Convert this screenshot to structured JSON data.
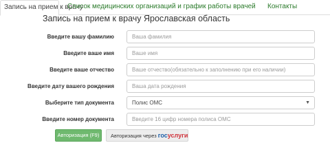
{
  "tabs": [
    {
      "label": "Запись на прием к врачу",
      "active": true
    },
    {
      "label": "Список медицинских организаций и график работы врачей",
      "active": false
    },
    {
      "label": "Контакты",
      "active": false
    }
  ],
  "form": {
    "title": "Запись на прием к врачу Ярославская область",
    "fields": [
      {
        "label": "Введите вашу фамилию",
        "placeholder": "Ваша фамилия"
      },
      {
        "label": "Введите ваше имя",
        "placeholder": "Ваше имя"
      },
      {
        "label": "Введите ваше отчество",
        "placeholder": "Ваше отчество(обязательно к заполнению при его наличии)"
      },
      {
        "label": "Введите дату вашего рождения",
        "placeholder": "Ваша дата рождения"
      },
      {
        "label": "Выберите тип документа",
        "value": "Полис ОМС"
      },
      {
        "label": "Введите номер документа",
        "placeholder": "Введите 16 цифр номера полиса ОМС"
      }
    ]
  },
  "buttons": {
    "auth_label": "Авторизация (F9)",
    "gos_prefix": "Авторизация через",
    "gos_logo_part1": "гос",
    "gos_logo_part2": "услуги"
  },
  "colors": {
    "tab_link": "#2a7a2a",
    "auth_button": "#6fb96f",
    "gos_blue": "#1d5fa8",
    "gos_red": "#d0323a"
  }
}
